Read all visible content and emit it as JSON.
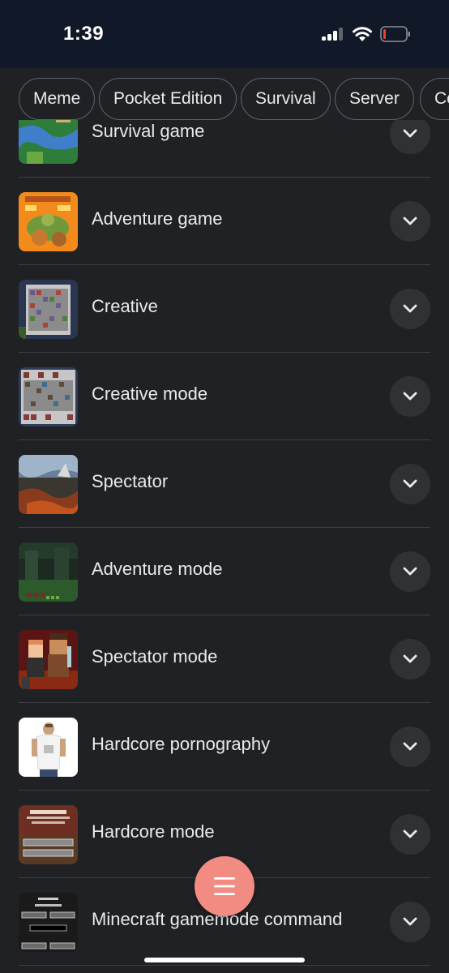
{
  "status_bar": {
    "time": "1:39",
    "icons": [
      "cellular-signal-icon",
      "wifi-icon",
      "battery-low-icon"
    ],
    "battery_color": "#e94235"
  },
  "filter_chips": [
    "Meme",
    "Pocket Edition",
    "Survival",
    "Server",
    "Co"
  ],
  "results": [
    {
      "label": "Survival game",
      "thumbnail": "survival-game-thumbnail"
    },
    {
      "label": "Adventure game",
      "thumbnail": "adventure-game-thumbnail"
    },
    {
      "label": "Creative",
      "thumbnail": "creative-thumbnail"
    },
    {
      "label": "Creative mode",
      "thumbnail": "creative-mode-thumbnail"
    },
    {
      "label": "Spectator",
      "thumbnail": "spectator-thumbnail"
    },
    {
      "label": "Adventure mode",
      "thumbnail": "adventure-mode-thumbnail"
    },
    {
      "label": "Spectator mode",
      "thumbnail": "spectator-mode-thumbnail"
    },
    {
      "label": "Hardcore pornography",
      "thumbnail": "hardcore-pornography-thumbnail"
    },
    {
      "label": "Hardcore mode",
      "thumbnail": "hardcore-mode-thumbnail"
    },
    {
      "label": "Minecraft gamemode command",
      "thumbnail": "minecraft-gamemode-command-thumbnail"
    }
  ],
  "expand_icon": "chevron-down-icon",
  "fab": {
    "icon": "menu-icon",
    "color": "#f28b82"
  },
  "colors": {
    "background": "#202124",
    "status_bar": "#111827",
    "divider": "#3c4043",
    "chip_border": "#5f6368",
    "expand_bg": "#303134"
  }
}
